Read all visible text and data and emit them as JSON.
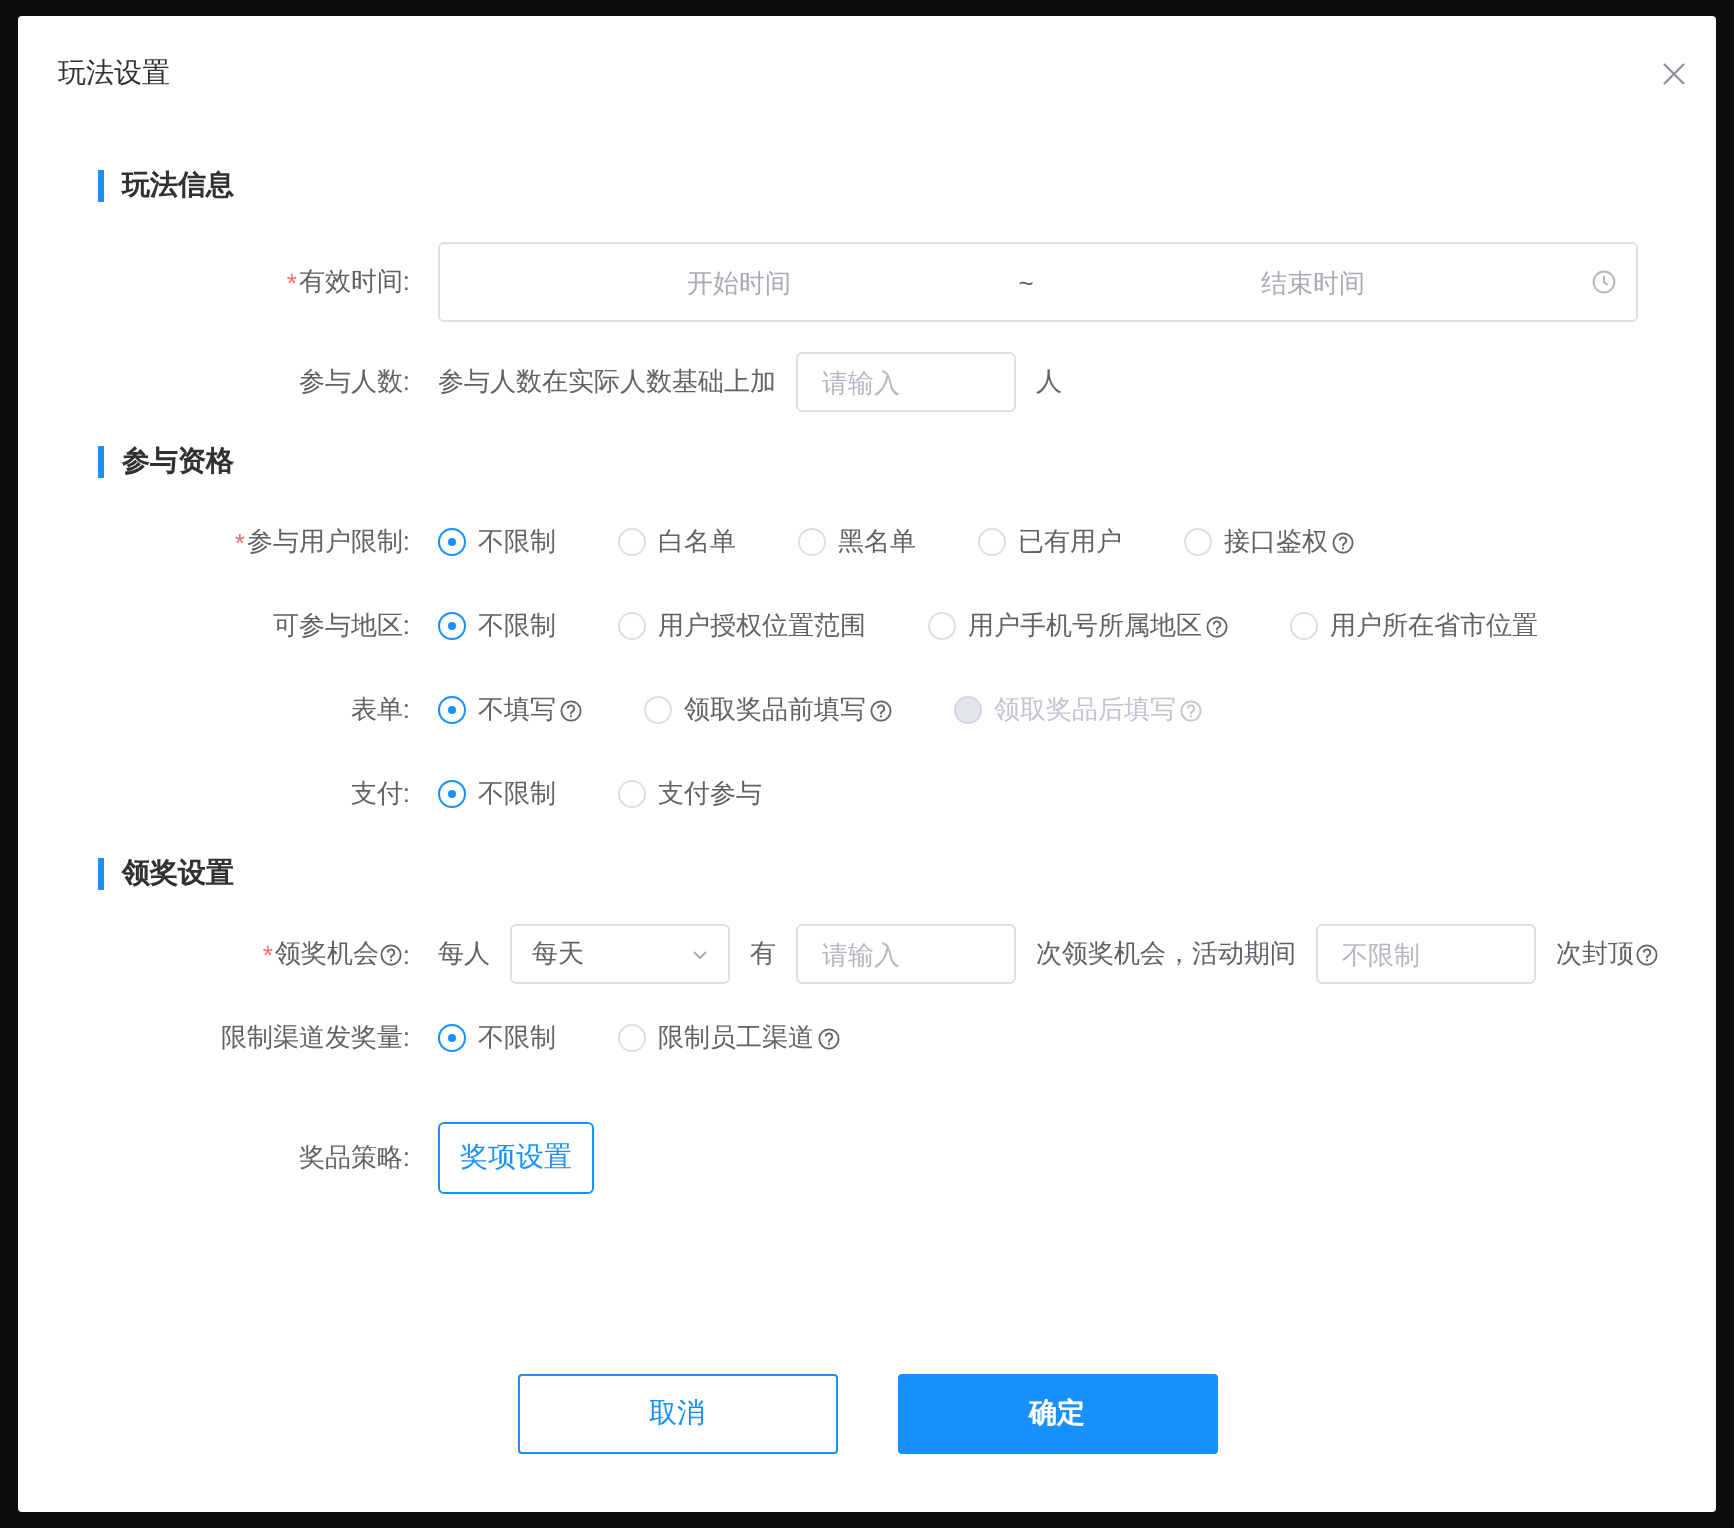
{
  "dialog": {
    "title": "玩法设置"
  },
  "sections": [
    {
      "title": "玩法信息",
      "rows": [
        {
          "kind": "daterange",
          "label": {
            "text": "有效时间:",
            "required_mark": "*"
          },
          "start_placeholder": "开始时间",
          "separator": "~",
          "end_placeholder": "结束时间"
        },
        {
          "kind": "inline",
          "label": {
            "text": "参与人数:"
          },
          "parts": [
            {
              "kind": "text",
              "text": "参与人数在实际人数基础上加"
            },
            {
              "kind": "input",
              "placeholder": "请输入"
            },
            {
              "kind": "text",
              "text": "人"
            }
          ]
        }
      ]
    },
    {
      "title": "参与资格",
      "rows": [
        {
          "kind": "radio",
          "label": {
            "text": "参与用户限制:",
            "required_mark": "*"
          },
          "options": [
            {
              "label": "不限制",
              "selected": true,
              "disabled": false
            },
            {
              "label": "白名单",
              "selected": false,
              "disabled": false
            },
            {
              "label": "黑名单",
              "selected": false,
              "disabled": false
            },
            {
              "label": "已有用户",
              "selected": false,
              "disabled": false
            },
            {
              "label": "接口鉴权",
              "selected": false,
              "disabled": false,
              "help": true
            }
          ]
        },
        {
          "kind": "radio",
          "label": {
            "text": "可参与地区:"
          },
          "options": [
            {
              "label": "不限制",
              "selected": true,
              "disabled": false
            },
            {
              "label": "用户授权位置范围",
              "selected": false,
              "disabled": false
            },
            {
              "label": "用户手机号所属地区",
              "selected": false,
              "disabled": false,
              "help": true
            },
            {
              "label": "用户所在省市位置",
              "selected": false,
              "disabled": false
            }
          ]
        },
        {
          "kind": "radio",
          "label": {
            "text": "表单:"
          },
          "options": [
            {
              "label": "不填写",
              "selected": true,
              "disabled": false,
              "help": true
            },
            {
              "label": "领取奖品前填写",
              "selected": false,
              "disabled": false,
              "help": true
            },
            {
              "label": "领取奖品后填写",
              "selected": false,
              "disabled": true,
              "help": true
            }
          ]
        },
        {
          "kind": "radio",
          "label": {
            "text": "支付:"
          },
          "options": [
            {
              "label": "不限制",
              "selected": true,
              "disabled": false
            },
            {
              "label": "支付参与",
              "selected": false,
              "disabled": false
            }
          ]
        }
      ]
    },
    {
      "title": "领奖设置",
      "rows": [
        {
          "kind": "inline",
          "label": {
            "text": "领奖机会",
            "suffix": ":",
            "required_mark": "*",
            "help": true
          },
          "parts": [
            {
              "kind": "text",
              "text": "每人"
            },
            {
              "kind": "select",
              "value": "每天"
            },
            {
              "kind": "text",
              "text": "有"
            },
            {
              "kind": "input",
              "placeholder": "请输入"
            },
            {
              "kind": "text",
              "text": "次领奖机会，活动期间"
            },
            {
              "kind": "input",
              "placeholder": "不限制"
            },
            {
              "kind": "text",
              "text": "次封顶",
              "help": true
            }
          ]
        },
        {
          "kind": "radio",
          "label": {
            "text": "限制渠道发奖量:"
          },
          "options": [
            {
              "label": "不限制",
              "selected": true,
              "disabled": false
            },
            {
              "label": "限制员工渠道",
              "selected": false,
              "disabled": false,
              "help": true
            }
          ]
        },
        {
          "kind": "button",
          "label": {
            "text": "奖品策略:"
          },
          "button": "奖项设置"
        }
      ]
    }
  ],
  "footer": {
    "buttons": [
      {
        "label": "取消",
        "kind": "secondary"
      },
      {
        "label": "确定",
        "kind": "primary"
      }
    ]
  }
}
